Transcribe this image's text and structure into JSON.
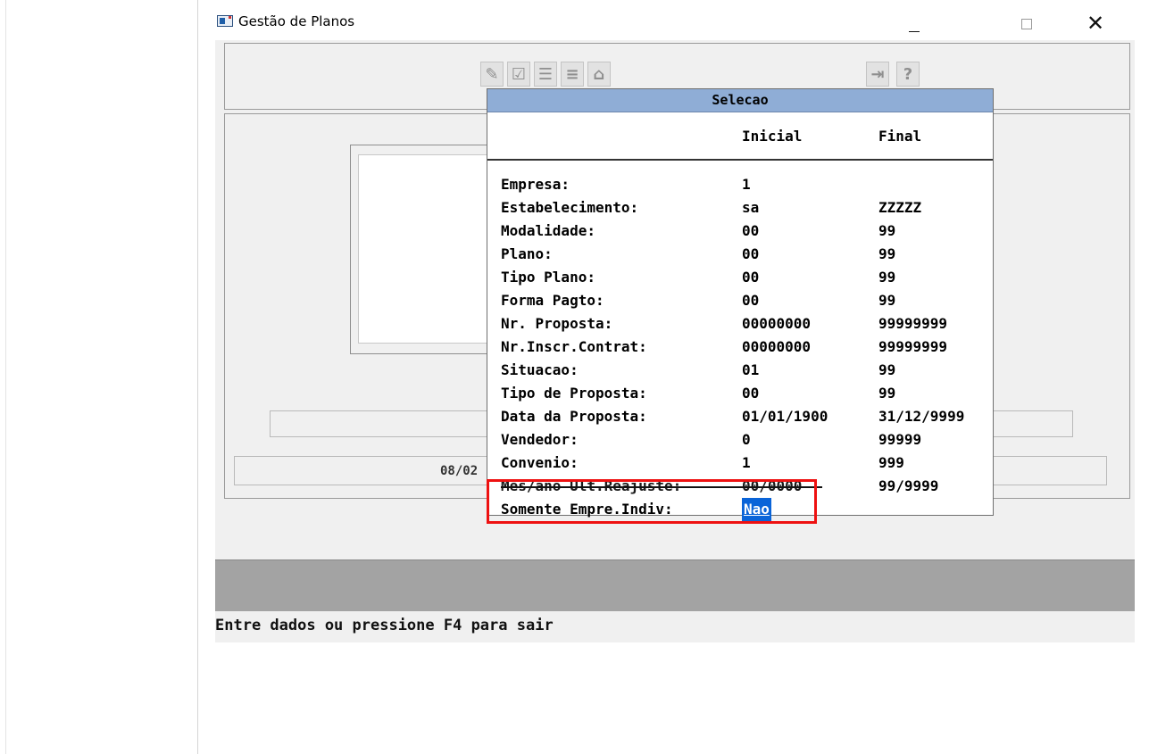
{
  "window": {
    "title": "Gestão de Planos",
    "minimize_glyph": "—",
    "close_glyph": "✕"
  },
  "toolbar": {
    "icons": [
      "tools-icon",
      "check-list-icon",
      "list-icon",
      "indent-list-icon",
      "home-icon",
      "exit-icon",
      "help-icon"
    ],
    "glyphs": [
      "✎",
      "☑",
      "☰",
      "≡",
      "⌂",
      "⇥",
      "?"
    ]
  },
  "main": {
    "status_field_text": "08/02"
  },
  "status_bar": {
    "message": "Entre dados ou pressione F4 para sair"
  },
  "dialog": {
    "title": "Selecao",
    "header_inicial": "Inicial",
    "header_final": "Final",
    "rows": [
      {
        "label": "Empresa:",
        "inicial": "1",
        "final": ""
      },
      {
        "label": "Estabelecimento:",
        "inicial": "sa",
        "final": "ZZZZZ"
      },
      {
        "label": "Modalidade:",
        "inicial": "00",
        "final": "99"
      },
      {
        "label": "Plano:",
        "inicial": "00",
        "final": "99"
      },
      {
        "label": "Tipo Plano:",
        "inicial": "00",
        "final": "99"
      },
      {
        "label": "Forma Pagto:",
        "inicial": "00",
        "final": "99"
      },
      {
        "label": "Nr. Proposta:",
        "inicial": "00000000",
        "final": "99999999"
      },
      {
        "label": "Nr.Inscr.Contrat:",
        "inicial": "00000000",
        "final": "99999999"
      },
      {
        "label": "Situacao:",
        "inicial": "01",
        "final": "99"
      },
      {
        "label": "Tipo de Proposta:",
        "inicial": "00",
        "final": "99"
      },
      {
        "label": "Data da Proposta:",
        "inicial": "01/01/1900",
        "final": "31/12/9999"
      },
      {
        "label": "Vendedor:",
        "inicial": "0",
        "final": "99999"
      },
      {
        "label": "Convenio:",
        "inicial": "1",
        "final": "999"
      },
      {
        "label": "Mes/ano Ult.Reajuste:",
        "inicial": "00/0000",
        "final": "99/9999"
      }
    ],
    "last_row": {
      "label": "Somente Empre.Indiv:",
      "value": "Nao"
    }
  },
  "colors": {
    "dialog_title_bg": "#8fadd6",
    "selection": "#0a64d8",
    "highlight": "#e11111"
  }
}
